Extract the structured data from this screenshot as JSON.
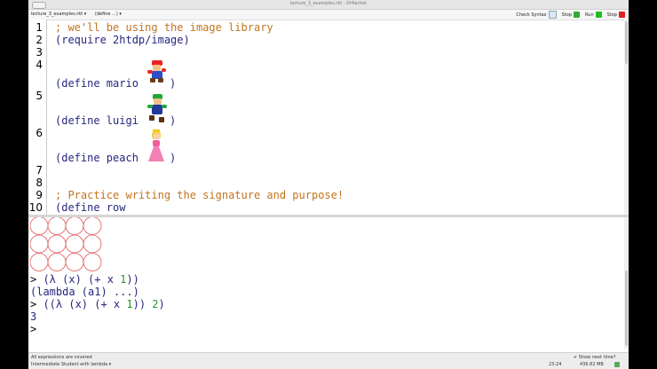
{
  "window": {
    "title": "lecture_3_examples.rkt - DrRacket"
  },
  "toolbar": {
    "file_tab": "lecture_3_examples.rkt ▾",
    "define_menu": "(define ...) ▾",
    "check_syntax": "Check Syntax",
    "stop1": "Stop",
    "run": "Run",
    "stop2": "Stop"
  },
  "editor": {
    "line_numbers": [
      "1",
      "2",
      "3",
      "4",
      "5",
      "6",
      "7",
      "8",
      "9",
      "10"
    ],
    "line1": "; we'll be using the image library",
    "line2": "(require 2htdp/image)",
    "mario_open": "(define mario ",
    "mario_close": ")",
    "luigi_open": "(define luigi ",
    "luigi_close": ")",
    "peach_open": "(define peach ",
    "peach_close": ")",
    "line9": "; Practice writing the signature and purpose!",
    "line10": "(define row"
  },
  "repl": {
    "prompt1": "> ",
    "expr1_open": "(λ (x) (+ x ",
    "expr1_num": "1",
    "expr1_close": "))",
    "result1": "(lambda (a1) ...)",
    "prompt2": "> ",
    "expr2_open": "((λ (x) (+ x ",
    "expr2_num1": "1",
    "expr2_mid": ")) ",
    "expr2_num2": "2",
    "expr2_close": ")",
    "result2": "3",
    "prompt3": ">"
  },
  "status": {
    "message": "All expressions are covered",
    "language": "Intermediate Student with lambda ▾",
    "show_next_time": "✔ Show next time?",
    "position": "23:24",
    "memory": "436.82 MB"
  },
  "colors": {
    "comment": "#c2741f",
    "code": "#262680",
    "number": "#229922",
    "circle": "#e05a5a"
  }
}
